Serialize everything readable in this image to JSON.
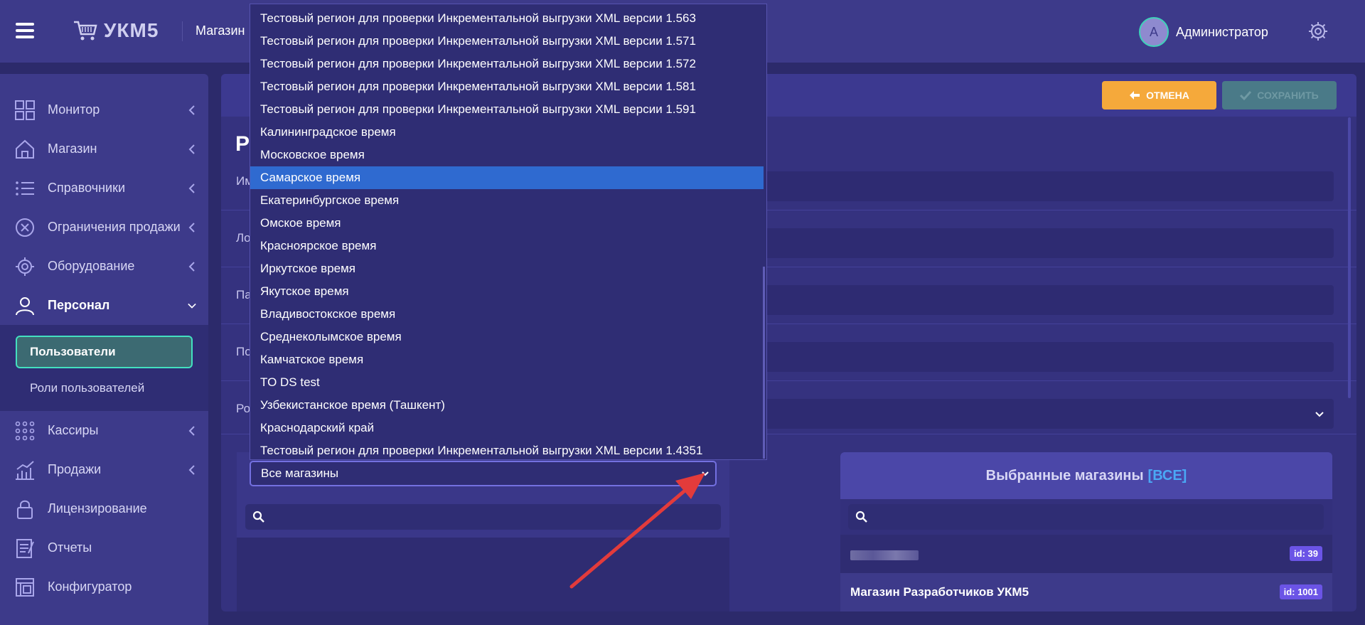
{
  "header": {
    "logo_text": "УКМ5",
    "breadcrumb": "Магазин",
    "user_initial": "А",
    "user_name": "Администратор"
  },
  "sidebar": {
    "items": [
      {
        "label": "Монитор",
        "icon": "monitor-grid-icon"
      },
      {
        "label": "Магазин",
        "icon": "store-house-icon"
      },
      {
        "label": "Справочники",
        "icon": "list-icon"
      },
      {
        "label": "Ограничения продажи",
        "icon": "restriction-x-icon"
      },
      {
        "label": "Оборудование",
        "icon": "gear-icon"
      },
      {
        "label": "Персонал",
        "icon": "person-icon"
      },
      {
        "label": "Кассиры",
        "icon": "dots-grid-icon"
      },
      {
        "label": "Продажи",
        "icon": "sales-chart-icon"
      },
      {
        "label": "Лицензирование",
        "icon": "lock-icon"
      },
      {
        "label": "Отчеты",
        "icon": "report-icon"
      },
      {
        "label": "Конфигуратор",
        "icon": "configurator-icon"
      }
    ],
    "submenu": {
      "active": "Пользователи",
      "other": "Роли пользователей"
    }
  },
  "toolbar": {
    "cancel_label": "ОТМЕНА",
    "save_label": "СОХРАНИТЬ"
  },
  "form": {
    "title": "Р",
    "labels": [
      "Им",
      "Ло",
      "Па",
      "По",
      "Ро"
    ]
  },
  "stores": {
    "filter_selected": "Все магазины",
    "selected_title": "Выбранные магазины",
    "selected_all": "[ВСЕ]",
    "rows": [
      {
        "name": "",
        "badge": "id: 39"
      },
      {
        "name": "Магазин Разработчиков УКМ5",
        "badge": "id: 1001"
      }
    ]
  },
  "dropdown": {
    "options": [
      "Тестовый регион для проверки Инкрементальной выгрузки XML версии 1.563",
      "Тестовый регион для проверки Инкрементальной выгрузки XML версии 1.571",
      "Тестовый регион для проверки Инкрементальной выгрузки XML версии 1.572",
      "Тестовый регион для проверки Инкрементальной выгрузки XML версии 1.581",
      "Тестовый регион для проверки Инкрементальной выгрузки XML версии 1.591",
      "Калининградское время",
      "Московское время",
      "Самарское время",
      "Екатеринбургское время",
      "Омское время",
      "Красноярское время",
      "Иркутское время",
      "Якутское время",
      "Владивостокское время",
      "Среднеколымское время",
      "Камчатское время",
      "TO DS test",
      "Узбекистанское время (Ташкент)",
      "Краснодарский край",
      "Тестовый регион для проверки Инкрементальной выгрузки XML версии 1.4351"
    ],
    "selected": "Самарское время"
  },
  "colors": {
    "accent_teal": "#43e0c0",
    "cancel_orange": "#f5a93b",
    "selected_blue": "#2f6ad0",
    "arrow_red": "#e33b3b"
  }
}
